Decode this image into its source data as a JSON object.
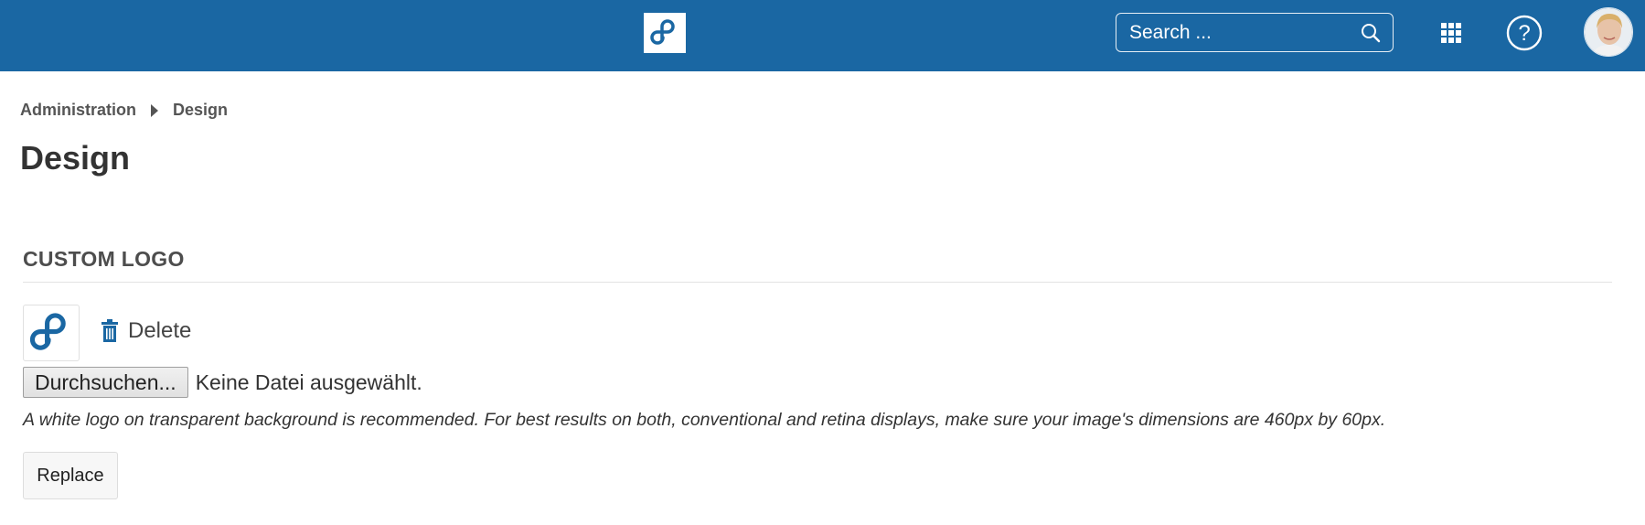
{
  "header": {
    "logo_icon": "openproject-logo-icon",
    "brand_color": "#1a67a3",
    "search": {
      "placeholder": "Search ...",
      "value": ""
    },
    "search_icon": "search-icon",
    "modules_icon": "grid-icon",
    "help_icon": "help-icon",
    "avatar": "user-avatar"
  },
  "breadcrumb": {
    "items": [
      "Administration",
      "Design"
    ]
  },
  "page": {
    "title": "Design"
  },
  "custom_logo": {
    "section_title": "CUSTOM LOGO",
    "current_logo_icon": "openproject-logo-icon",
    "delete_label": "Delete",
    "delete_icon": "trash-icon",
    "browse_label": "Durchsuchen...",
    "file_status": "Keine Datei ausgewählt.",
    "hint": "A white logo on transparent background is recommended. For best results on both, conventional and retina displays, make sure your image's dimensions are 460px by 60px.",
    "replace_label": "Replace"
  }
}
